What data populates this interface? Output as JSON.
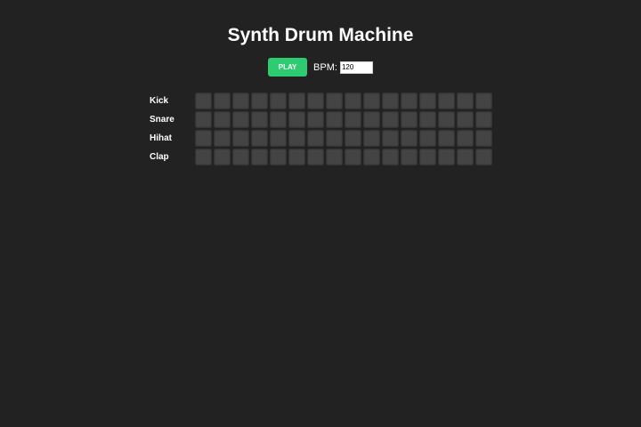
{
  "header": {
    "title": "Synth Drum Machine"
  },
  "controls": {
    "play_label": "PLAY",
    "bpm_label": "BPM:",
    "bpm_value": "120"
  },
  "sequencer": {
    "steps_per_track": 16,
    "tracks": [
      {
        "label": "Kick"
      },
      {
        "label": "Snare"
      },
      {
        "label": "Hihat"
      },
      {
        "label": "Clap"
      }
    ]
  },
  "colors": {
    "background": "#222222",
    "play_button": "#2ecc71",
    "step_inactive": "#444444"
  }
}
